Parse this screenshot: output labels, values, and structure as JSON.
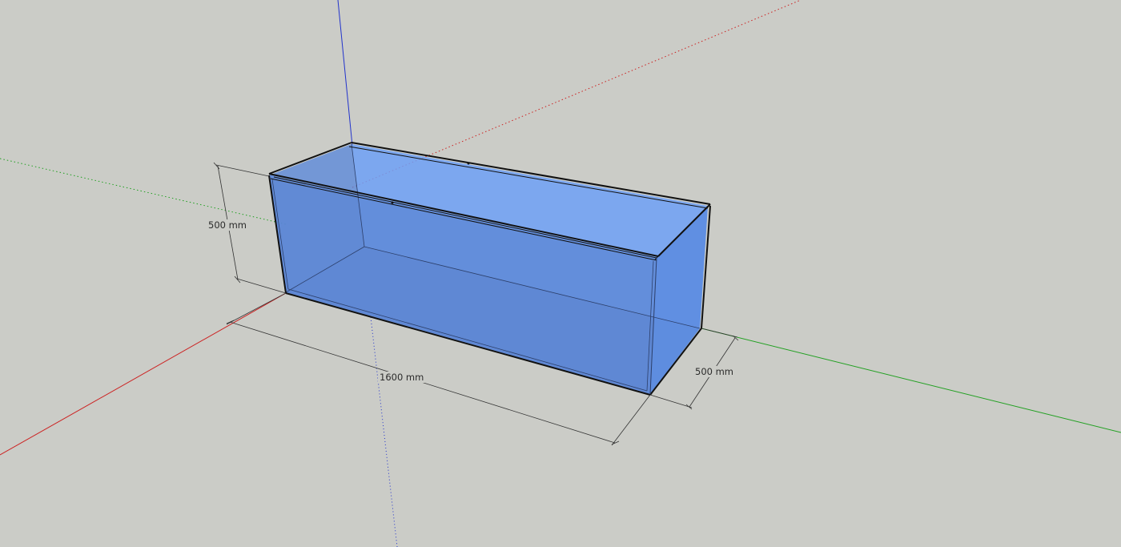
{
  "viewport": {
    "background": "#cbccc7"
  },
  "axes": {
    "red_axis_color": "#cc2222",
    "green_axis_color": "#22a022",
    "blue_axis_color": "#2233cc"
  },
  "model": {
    "glass_color": "#5b8ee6",
    "edge_color": "#111111"
  },
  "dimensions": {
    "height_label": "500 mm",
    "length_label": "1600 mm",
    "depth_label": "500 mm"
  }
}
